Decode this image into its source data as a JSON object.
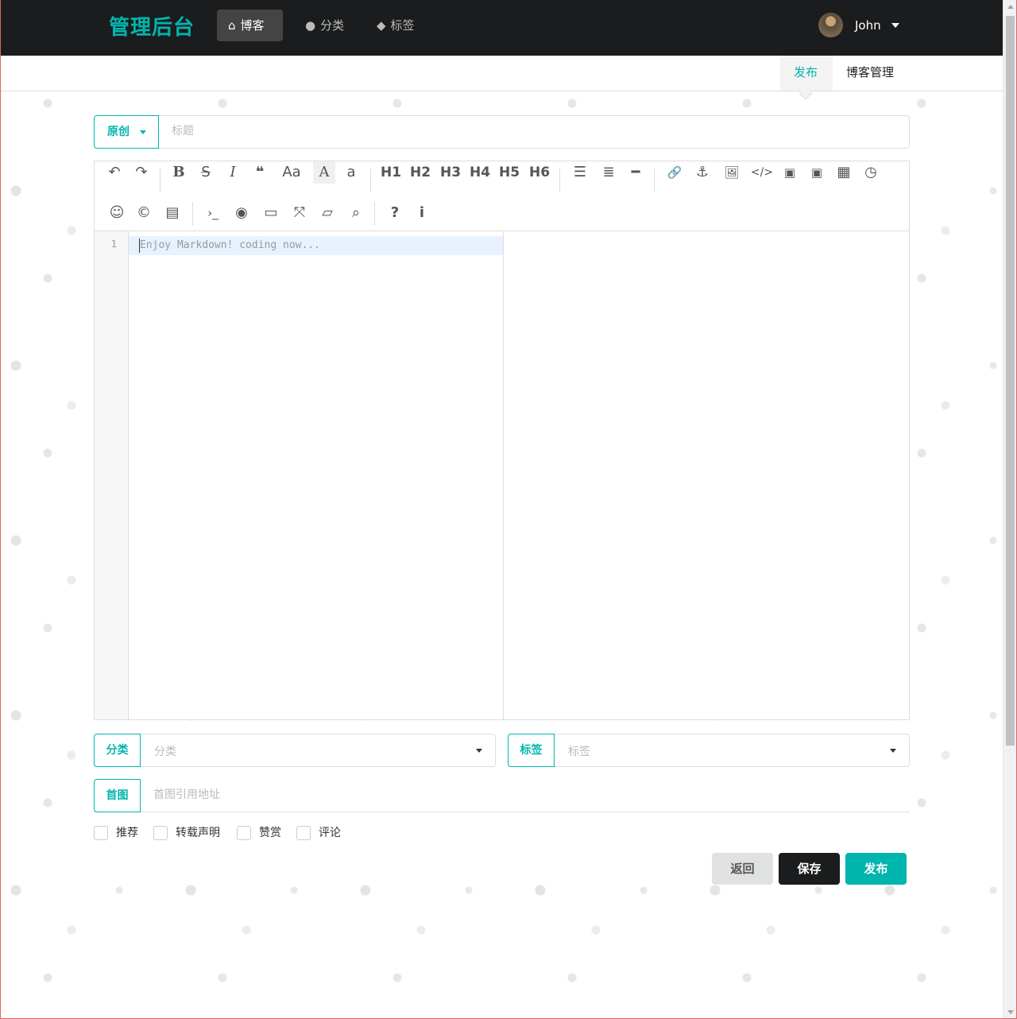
{
  "navbar": {
    "brand": "管理后台",
    "items": [
      {
        "label": "博客",
        "icon": "home-icon",
        "active": true
      },
      {
        "label": "分类",
        "icon": "lightbulb-icon",
        "active": false
      },
      {
        "label": "标签",
        "icon": "tags-icon",
        "active": false
      }
    ],
    "user": {
      "name": "John"
    }
  },
  "subnav": {
    "tabs": [
      {
        "label": "发布",
        "active": true
      },
      {
        "label": "博客管理",
        "active": false
      }
    ]
  },
  "title_row": {
    "flag": "原创",
    "placeholder": "标题"
  },
  "editor": {
    "toolbar_row1": [
      "↶",
      "↷",
      "B",
      "S",
      "I",
      "❝",
      "Aa",
      "A",
      "a",
      "H1",
      "H2",
      "H3",
      "H4",
      "H5",
      "H6",
      "☰",
      "≣",
      "━",
      "🔗",
      "⚓",
      "🖼",
      "</>",
      "▣",
      "▣",
      "▦",
      "◷"
    ],
    "toolbar_row2": [
      "☺",
      "©",
      "▤",
      "›_",
      "◉",
      "▭",
      "⤧",
      "▱",
      "⌕",
      "?",
      "i"
    ],
    "line_number": "1",
    "placeholder": "Enjoy Markdown! coding now..."
  },
  "type_select": {
    "label": "分类",
    "placeholder": "分类"
  },
  "tag_select": {
    "label": "标签",
    "placeholder": "标签"
  },
  "first_picture": {
    "label": "首图",
    "placeholder": "首图引用地址"
  },
  "options": [
    {
      "label": "推荐"
    },
    {
      "label": "转载声明"
    },
    {
      "label": "赞赏"
    },
    {
      "label": "评论"
    }
  ],
  "buttons": {
    "back": "返回",
    "save": "保存",
    "publish": "发布"
  },
  "colors": {
    "accent": "#00b5ad",
    "navbar_bg": "#1b1c1d"
  }
}
